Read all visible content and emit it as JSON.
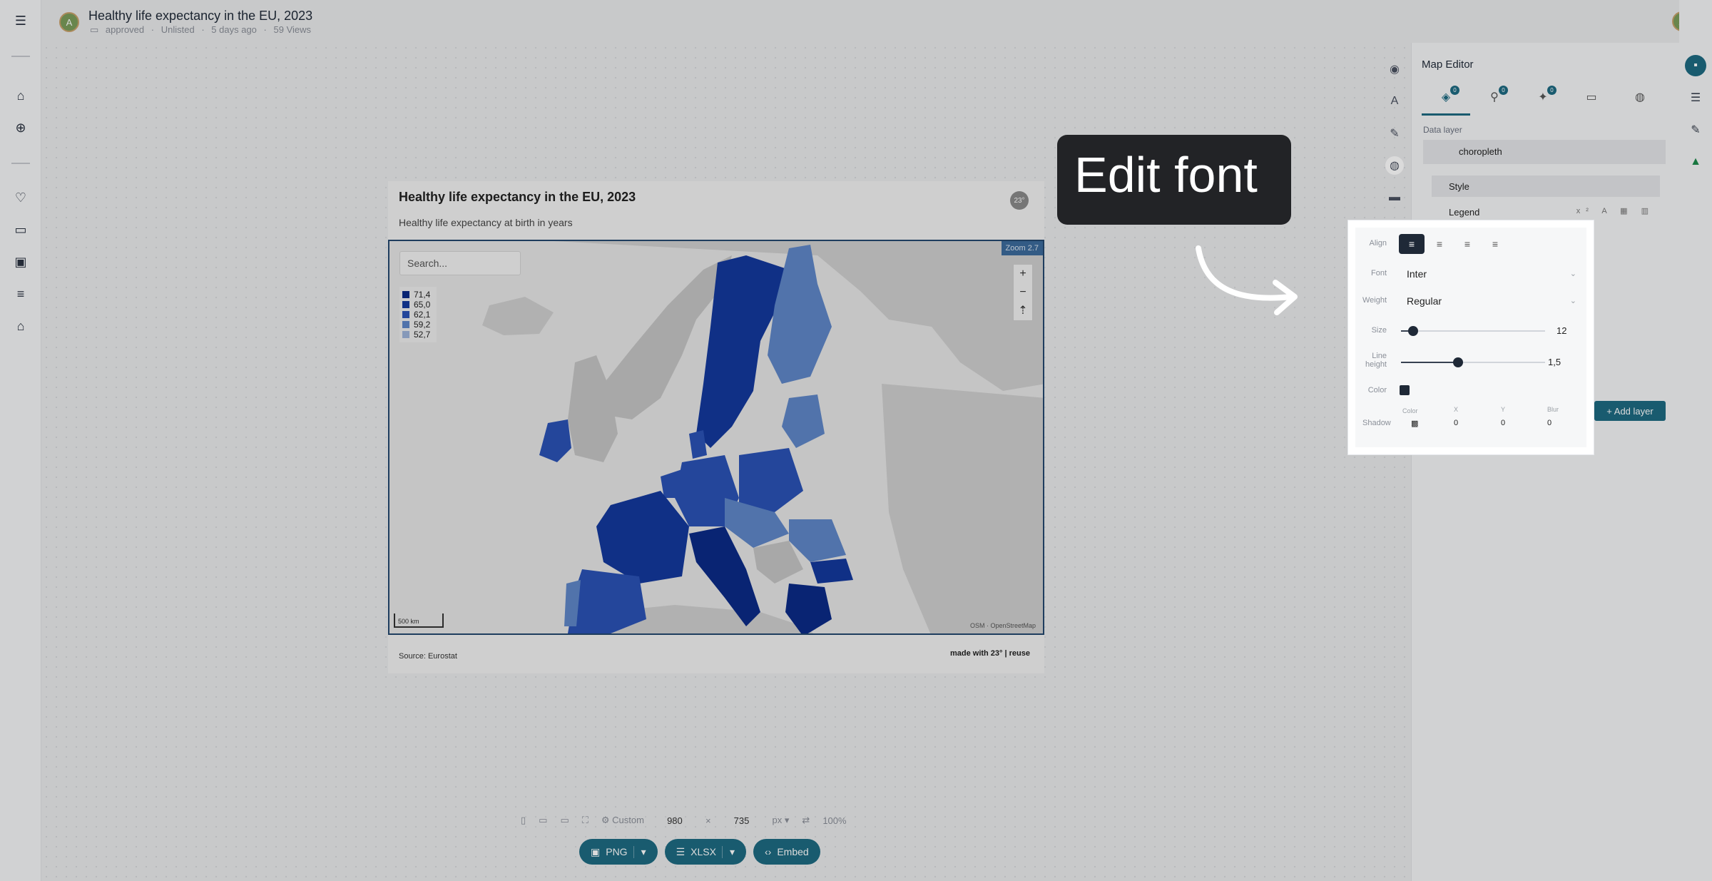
{
  "header": {
    "title": "Healthy life expectancy in the EU, 2023",
    "meta": [
      "approved",
      "Unlisted",
      "5 days ago",
      "59 Views"
    ],
    "avatar_initial": "A"
  },
  "chart_card": {
    "title": "Healthy life expectancy in the EU, 2023",
    "subtitle": "Healthy life expectancy at birth in years",
    "badge": "23°",
    "search_placeholder": "Search...",
    "zoom_label": "Zoom 2.7",
    "scale_label": "500 km",
    "attribution": "OSM · OpenStreetMap",
    "source": "Source: Eurostat",
    "made_with": "made with 23° | reuse"
  },
  "chart_data": {
    "type": "choropleth",
    "legend_placement": "top-left",
    "legend": [
      {
        "label": "71,4",
        "color": "#0b2a86"
      },
      {
        "label": "65,0",
        "color": "#13389c"
      },
      {
        "label": "62,1",
        "color": "#2a52b5"
      },
      {
        "label": "59,2",
        "color": "#5f86c7"
      },
      {
        "label": "52,7",
        "color": "#9cb3d8"
      }
    ]
  },
  "editor": {
    "title": "Map Editor",
    "tab_counts": [
      "0",
      "0",
      "0"
    ],
    "section_label": "Data layer",
    "layer_name": "choropleth",
    "style_label": "Style",
    "legend_label": "Legend",
    "add_layer": "+ Add layer"
  },
  "tooltip": {
    "text": "Edit font"
  },
  "font_popup": {
    "align_label": "Align",
    "font_label": "Font",
    "font_value": "Inter",
    "weight_label": "Weight",
    "weight_value": "Regular",
    "size_label": "Size",
    "size_value": "12",
    "line_height_label_1": "Line",
    "line_height_label_2": "height",
    "line_height_value": "1,5",
    "color_label": "Color",
    "shadow_label": "Shadow",
    "shadow_color_label": "Color",
    "shadow_x_label": "X",
    "shadow_y_label": "Y",
    "shadow_blur_label": "Blur",
    "shadow_x": "0",
    "shadow_y": "0",
    "shadow_blur": "0"
  },
  "bottom_bar": {
    "preset": "Custom",
    "width": "980",
    "times": "×",
    "height": "735",
    "unit": "px",
    "zoom": "100%"
  },
  "export": {
    "png": "PNG",
    "xlsx": "XLSX",
    "embed": "Embed"
  }
}
